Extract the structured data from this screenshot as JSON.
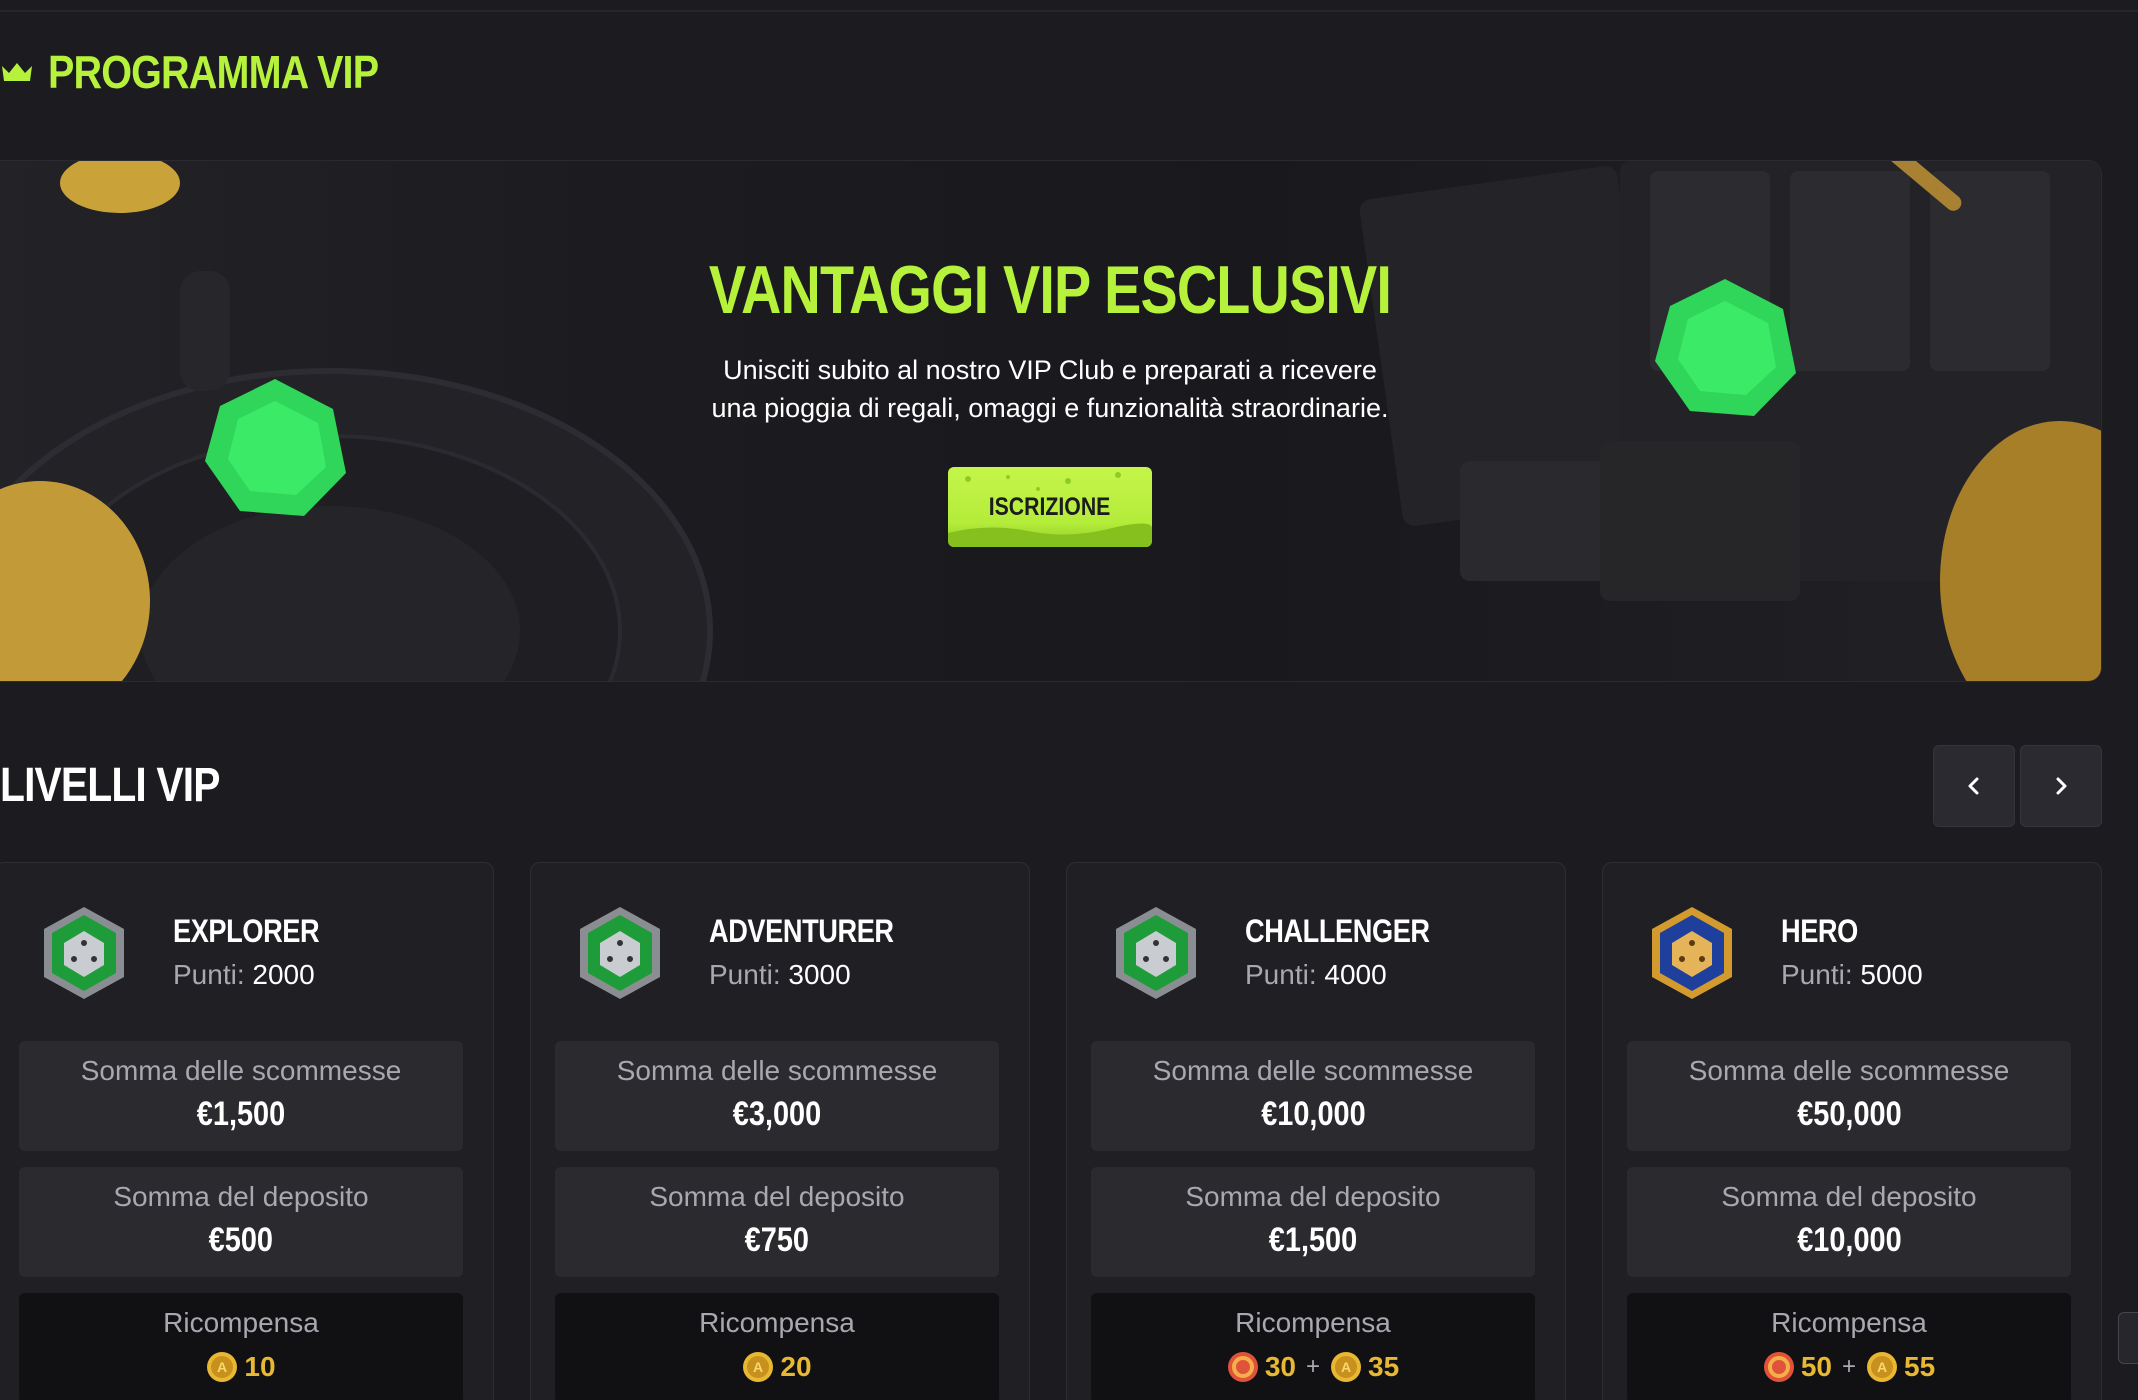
{
  "header": {
    "title": "PROGRAMMA VIP",
    "icon": "crown-icon"
  },
  "banner": {
    "title": "VANTAGGI VIP ESCLUSIVI",
    "text": "Unisciti subito al nostro VIP Club e preparati a ricevere una pioggia di regali, omaggi e funzionalità straordinarie.",
    "cta_label": "ISCRIZIONE"
  },
  "levels": {
    "title": "LIVELLI VIP",
    "points_label": "Punti:",
    "bets_label": "Somma delle scommesse",
    "deposit_label": "Somma del deposito",
    "reward_label": "Ricompensa",
    "plus": "+",
    "items": [
      {
        "name": "EXPLORER",
        "points": "2000",
        "bets": "€1,500",
        "deposit": "€500",
        "reward_spins": "",
        "reward_coins": "10",
        "badge": "green-dice-badge-icon"
      },
      {
        "name": "ADVENTURER",
        "points": "3000",
        "bets": "€3,000",
        "deposit": "€750",
        "reward_spins": "",
        "reward_coins": "20",
        "badge": "green-dice-badge-icon"
      },
      {
        "name": "CHALLENGER",
        "points": "4000",
        "bets": "€10,000",
        "deposit": "€1,500",
        "reward_spins": "30",
        "reward_coins": "35",
        "badge": "green-dice-badge-icon"
      },
      {
        "name": "HERO",
        "points": "5000",
        "bets": "€50,000",
        "deposit": "€10,000",
        "reward_spins": "50",
        "reward_coins": "55",
        "badge": "blue-gold-dice-badge-icon"
      }
    ]
  },
  "colors": {
    "accent": "#b6f23c",
    "background": "#1b1b20",
    "card": "#1f1f24",
    "stat": "#2a2a2f",
    "coin": "#e8b832"
  }
}
